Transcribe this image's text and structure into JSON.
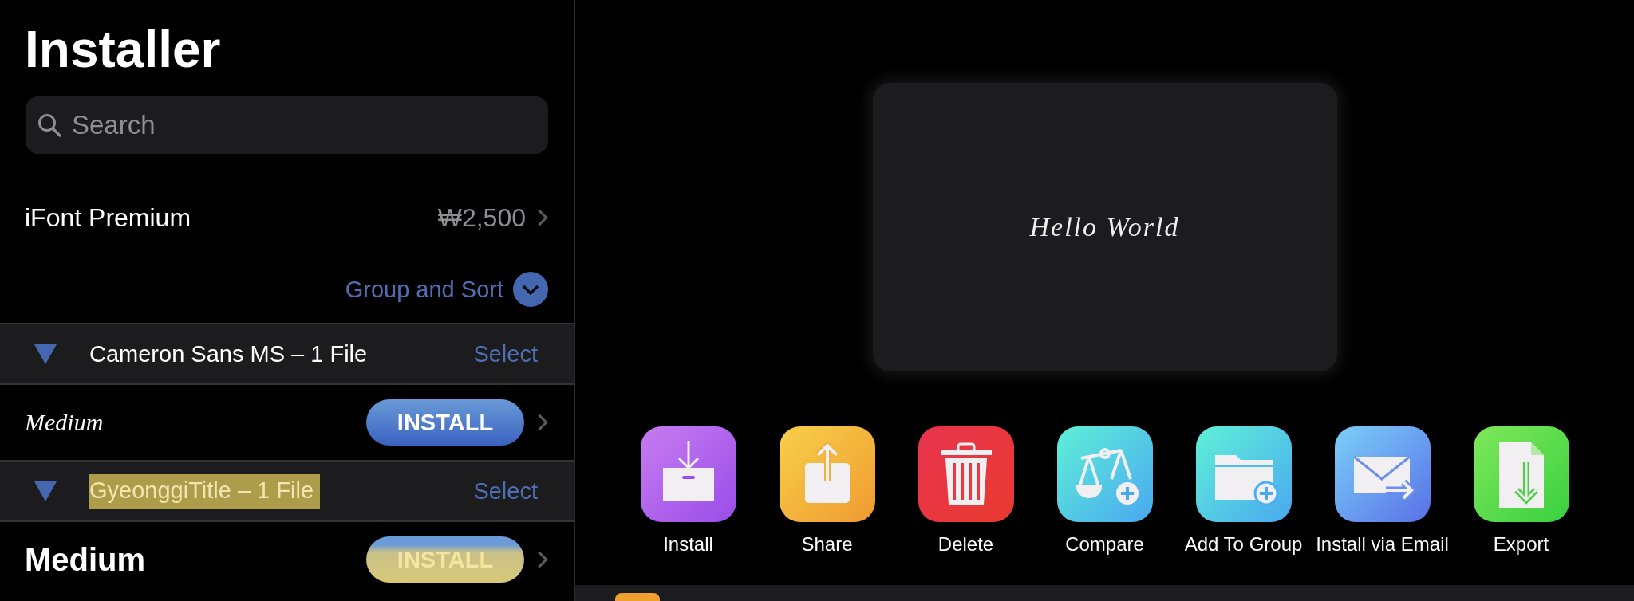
{
  "sidebar": {
    "title": "Installer",
    "search": {
      "placeholder": "Search"
    },
    "premium": {
      "label": "iFont Premium",
      "price": "₩2,500"
    },
    "group_sort": "Group and Sort",
    "groups": [
      {
        "title": "Cameron Sans MS – 1 File",
        "select": "Select",
        "expanded": true,
        "highlighted": false,
        "fonts": [
          {
            "style": "Medium",
            "kind": "script",
            "install": "INSTALL",
            "highlighted": false
          }
        ]
      },
      {
        "title": "GyeonggiTitle – 1 File",
        "select": "Select",
        "expanded": true,
        "highlighted": true,
        "fonts": [
          {
            "style": "Medium",
            "kind": "bold",
            "install": "INSTALL",
            "highlighted": true
          }
        ]
      }
    ]
  },
  "preview": {
    "text": "Hello World"
  },
  "actions": [
    {
      "label": "Install",
      "kind": "install"
    },
    {
      "label": "Share",
      "kind": "share"
    },
    {
      "label": "Delete",
      "kind": "delete"
    },
    {
      "label": "Compare",
      "kind": "compare"
    },
    {
      "label": "Add To Group",
      "kind": "group"
    },
    {
      "label": "Install via Email",
      "kind": "email"
    },
    {
      "label": "Export",
      "kind": "export"
    }
  ]
}
